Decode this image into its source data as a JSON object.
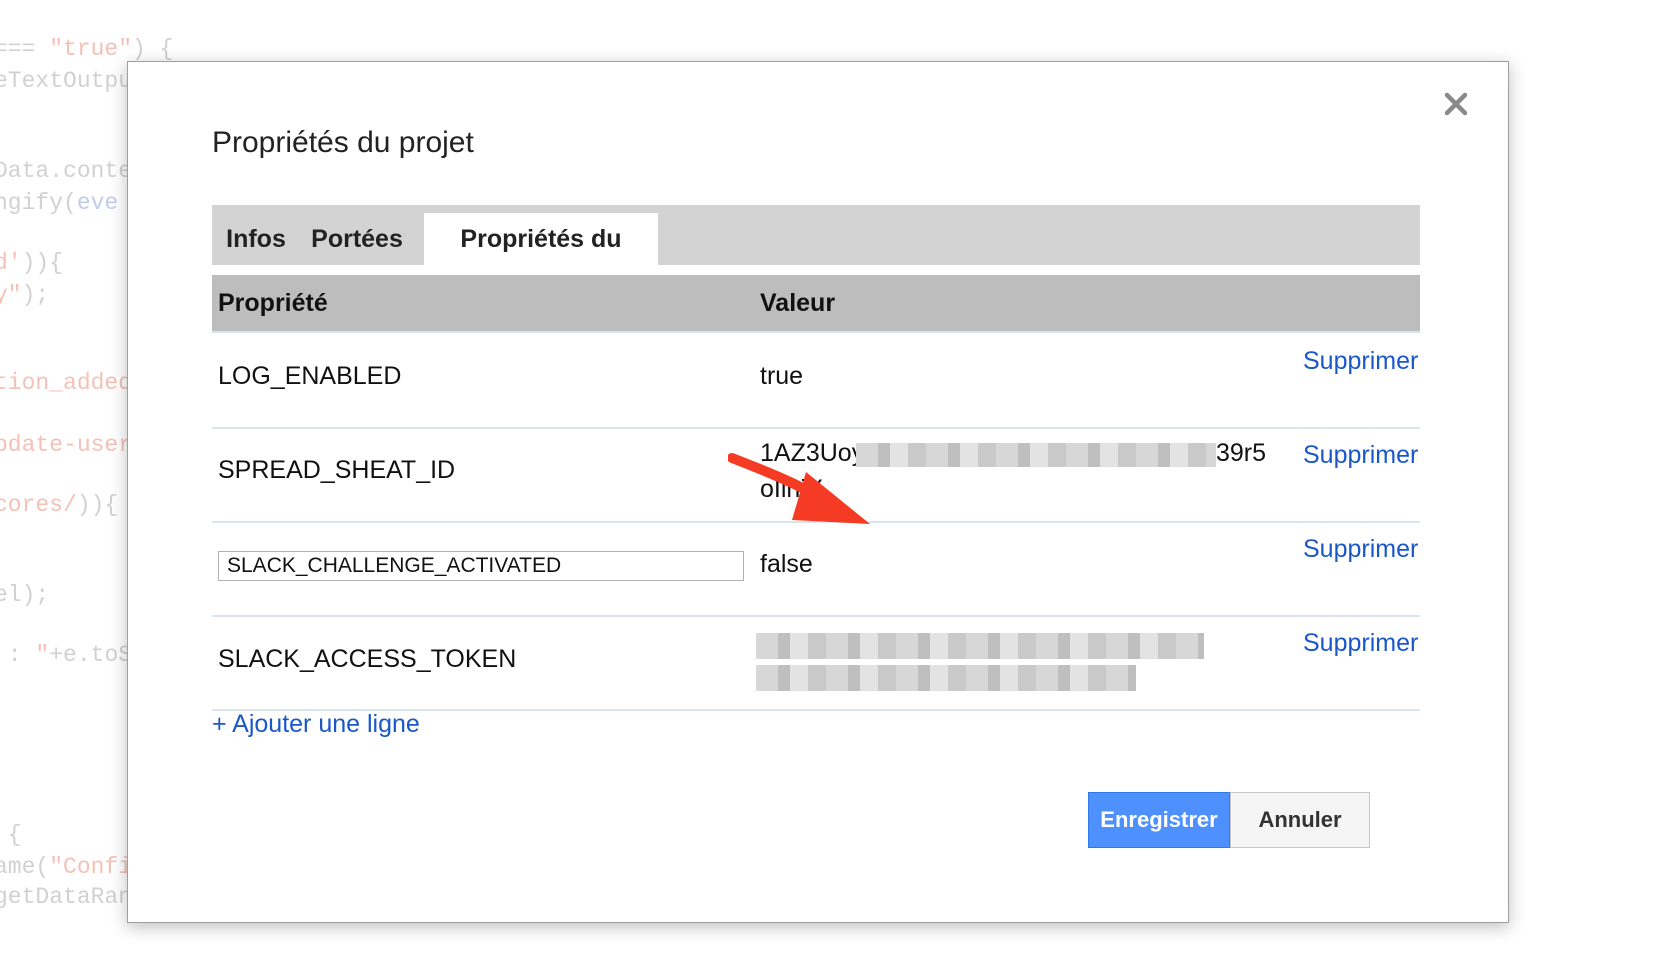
{
  "background_code": [
    {
      "t1": "=== ",
      "s": "\"true\"",
      "t2": ") {"
    },
    {
      "t1": "eTextOutpu",
      "s": "",
      "t2": ""
    },
    {
      "t1": "Data.conte",
      "s": "",
      "t2": ""
    },
    {
      "t1": "ngify(",
      "s": "",
      "t2": "",
      "k": "eve"
    },
    {
      "t1": "",
      "s": "d'",
      "t2": ")){"
    },
    {
      "t1": "",
      "s": "y\"",
      "t2": ");"
    },
    {
      "t1": "",
      "s": "tion_added",
      "t2": ""
    },
    {
      "t1": "",
      "s": "pdate-user",
      "t2": ""
    },
    {
      "t1": "",
      "s": "cores/",
      "t2": ")){"
    },
    {
      "t1": "el);",
      "s": "",
      "t2": ""
    },
    {
      "t1": " : ",
      "s": "\"",
      "t2": "+e.toS"
    },
    {
      "t1": " {",
      "s": "",
      "t2": ""
    },
    {
      "t1": "ame(",
      "s": "\"Config\"",
      "t2": ");"
    },
    {
      "t1": "getDataRange().getValues();",
      "s": "",
      "t2": ""
    }
  ],
  "dialog": {
    "title": "Propriétés du projet",
    "close_label": "×",
    "tabs": [
      {
        "label": "Infos"
      },
      {
        "label": "Portées"
      },
      {
        "label": "Propriétés du script",
        "active": true
      }
    ],
    "table": {
      "headers": {
        "property": "Propriété",
        "value": "Valeur"
      },
      "rows": [
        {
          "key": "LOG_ENABLED",
          "value": "true",
          "delete_label": "Supprimer"
        },
        {
          "key": "SPREAD_SHEAT_ID",
          "value_start": "1AZ3Uoy",
          "value_end": "39r5",
          "value_line2": "oIlnjY",
          "value_obscured": true,
          "delete_label": "Supprimer"
        },
        {
          "key": "SLACK_CHALLENGE_ACTIVATED",
          "key_editable": true,
          "value": "false",
          "delete_label": "Supprimer"
        },
        {
          "key": "SLACK_ACCESS_TOKEN",
          "value_obscured": true,
          "delete_label": "Supprimer"
        }
      ]
    },
    "add_row_label": "+ Ajouter une ligne",
    "buttons": {
      "save": "Enregistrer",
      "cancel": "Annuler"
    }
  },
  "colors": {
    "link": "#1a57c9",
    "primary_button": "#4d90fe",
    "annotation_arrow": "#f53b24"
  }
}
